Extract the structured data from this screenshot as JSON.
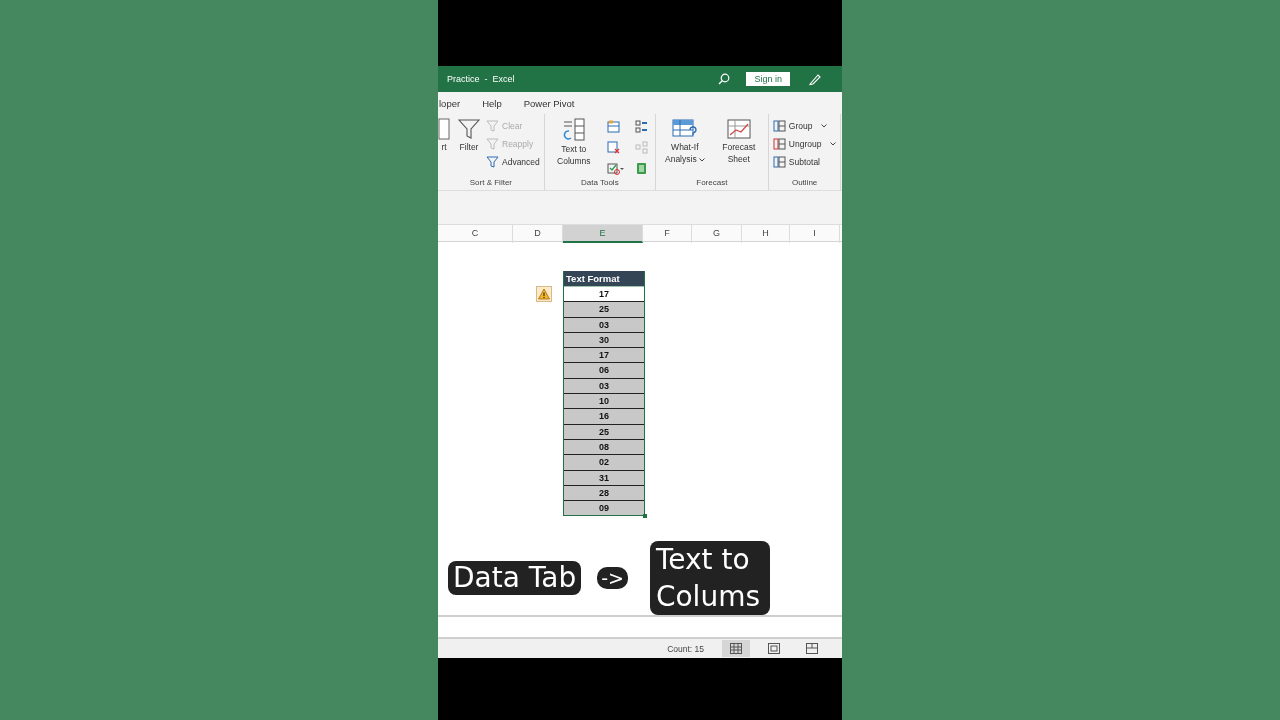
{
  "window": {
    "title": "Practice  -  Excel",
    "sign_in": "Sign in"
  },
  "ribbon_tabs": [
    {
      "label": "loper",
      "selected": false
    },
    {
      "label": "Help",
      "selected": false
    },
    {
      "label": "Power Pivot",
      "selected": false
    }
  ],
  "ribbon_groups": [
    {
      "kind": "sort_filter",
      "label": "Sort & Filter",
      "commands": [
        {
          "label": "rt",
          "disabled": false
        },
        {
          "label": "Filter",
          "disabled": false
        },
        {
          "label": "Clear",
          "disabled": true
        },
        {
          "label": "Reapply",
          "disabled": true
        },
        {
          "label": "Advanced",
          "disabled": false
        }
      ]
    },
    {
      "kind": "data_tools",
      "label": "Data Tools",
      "commands": [
        {
          "label": "Text to Columns",
          "disabled": false
        }
      ]
    },
    {
      "kind": "forecast",
      "label": "Forecast",
      "commands": [
        {
          "label": "What-If Analysis",
          "dropdown": true,
          "disabled": false
        },
        {
          "label": "Forecast Sheet",
          "dropdown": false,
          "disabled": false
        }
      ]
    },
    {
      "kind": "outline",
      "label": "Outline",
      "commands": [
        {
          "label": "Group",
          "dropdown": true,
          "disabled": false
        },
        {
          "label": "Ungroup",
          "dropdown": true,
          "disabled": false
        },
        {
          "label": "Subtotal",
          "dropdown": false,
          "disabled": false
        }
      ]
    }
  ],
  "column_headers": [
    {
      "label": "C",
      "selected": false
    },
    {
      "label": "D",
      "selected": false
    },
    {
      "label": "E",
      "selected": true
    },
    {
      "label": "F",
      "selected": false
    },
    {
      "label": "G",
      "selected": false
    },
    {
      "label": "H",
      "selected": false
    },
    {
      "label": "I",
      "selected": false
    }
  ],
  "table": {
    "header": "Text Format",
    "rows": [
      {
        "value": "17",
        "active": true
      },
      {
        "value": "25",
        "active": false
      },
      {
        "value": "03",
        "active": false
      },
      {
        "value": "30",
        "active": false
      },
      {
        "value": "17",
        "active": false
      },
      {
        "value": "06",
        "active": false
      },
      {
        "value": "03",
        "active": false
      },
      {
        "value": "10",
        "active": false
      },
      {
        "value": "16",
        "active": false
      },
      {
        "value": "25",
        "active": false
      },
      {
        "value": "08",
        "active": false
      },
      {
        "value": "02",
        "active": false
      },
      {
        "value": "31",
        "active": false
      },
      {
        "value": "28",
        "active": false
      },
      {
        "value": "09",
        "active": false
      }
    ]
  },
  "captions": [
    {
      "kind": "box",
      "text": "Data Tab"
    },
    {
      "kind": "pill",
      "text": "->"
    },
    {
      "kind": "box",
      "text": "Text to Colums"
    }
  ],
  "status_bar": {
    "count": "Count: 15",
    "views": [
      {
        "kind": "normal",
        "selected": true
      },
      {
        "kind": "page_layout",
        "selected": false
      },
      {
        "kind": "page_break",
        "selected": false
      }
    ]
  }
}
